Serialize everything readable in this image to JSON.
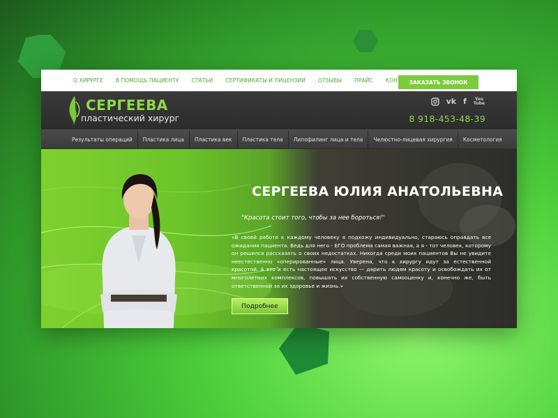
{
  "top_nav": {
    "items": [
      "О ХИРУРГЕ",
      "В ПОМОЩЬ ПАЦИЕНТУ",
      "СТАТЬИ",
      "СЕРТИФИКАТЫ И ЛИЦЕНЗИИ",
      "ОТЗЫВЫ",
      "ПРАЙС",
      "КОНТАКТЫ"
    ],
    "callback_label": "ЗАКАЗАТЬ ЗВОНОК"
  },
  "header": {
    "logo_name": "СЕРГЕЕВА",
    "logo_sub": "пластический хирург",
    "phone": "8 918-453-48-39",
    "socials": [
      "instagram-icon",
      "vk-icon",
      "facebook-icon",
      "youtube-icon"
    ]
  },
  "category_nav": {
    "items": [
      "Результаты операций",
      "Пластика лица",
      "Пластика век",
      "Пластика тела",
      "Липофилинг лица и тела",
      "Челюстно-лицевая хирургия",
      "Косметология"
    ]
  },
  "hero": {
    "title": "СЕРГЕЕВА ЮЛИЯ АНАТОЛЬЕВНА",
    "quote": "\"Красота стоит того, чтобы за нее бороться!\"",
    "text": "«В своей работе к каждому человеку я подхожу индивидуально, стараюсь оправдать все ожидания пациента. Ведь для него - ЕГО проблема самая важная, а я - тот человек, которому он решился рассказать о своих недостатках. Никогда среди моих пациентов Вы не увидите неестественно «оперированные» лица. Уверена, что к хирургу идут за естественной красотой. А это и есть настоящее искусство — дарить людям красоту и освобождать их от многолетних комплексов, повышать их собственную самооценку и, конечно же, быть ответственной за их здоровье и жизнь.»",
    "button_label": "Подробнее"
  },
  "colors": {
    "accent": "#8ed84a",
    "button": "#7ccb3a",
    "dark": "#2e2e2e"
  }
}
